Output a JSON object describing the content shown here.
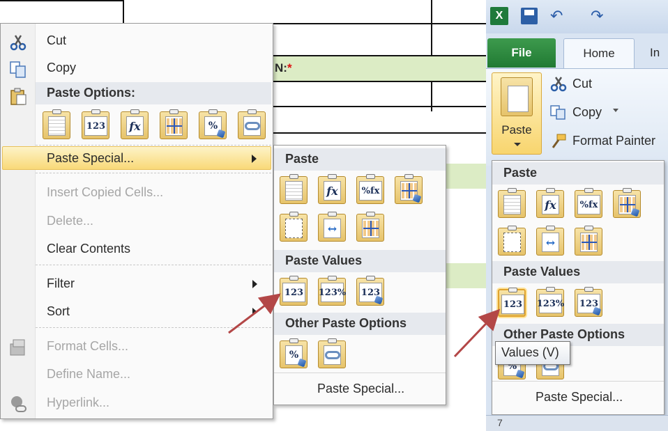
{
  "sheet": {
    "cell_label": "N:",
    "required_mark": "*"
  },
  "context_menu": {
    "items": {
      "cut": "Cut",
      "copy": "Copy",
      "paste_options_header": "Paste Options:",
      "paste_special": "Paste Special...",
      "insert_copied_cells": "Insert Copied Cells...",
      "delete": "Delete...",
      "clear_contents": "Clear Contents",
      "filter": "Filter",
      "sort": "Sort",
      "format_cells": "Format Cells...",
      "define_name": "Define Name...",
      "hyperlink": "Hyperlink..."
    },
    "paste_option_icons": [
      {
        "name": "paste-icon",
        "glyph": ""
      },
      {
        "name": "paste-values-icon",
        "glyph": "123"
      },
      {
        "name": "paste-formulas-icon",
        "glyph": "fx"
      },
      {
        "name": "transpose-icon",
        "glyph": ""
      },
      {
        "name": "paste-formatting-icon",
        "glyph": "%"
      },
      {
        "name": "paste-link-icon",
        "glyph": ""
      }
    ]
  },
  "submenu": {
    "headers": {
      "paste": "Paste",
      "paste_values": "Paste Values",
      "other_paste_options": "Other Paste Options"
    },
    "paste_special": "Paste Special...",
    "paste_icons": {
      "formulas": "fx",
      "formulas_number_format": "%fx",
      "values": "123",
      "values_number_format": "123%",
      "values_source_format": "123",
      "formatting": "%"
    }
  },
  "ribbon": {
    "tabs": {
      "file": "File",
      "home": "Home",
      "insert_partial": "In"
    },
    "paste_button": "Paste",
    "clipboard": {
      "cut": "Cut",
      "copy": "Copy",
      "format_painter": "Format Painter"
    },
    "gallery": {
      "headers": {
        "paste": "Paste",
        "paste_values": "Paste Values",
        "other_paste_options": "Other Paste Options"
      },
      "paste_special": "Paste Special..."
    },
    "tooltip": "Values (V)",
    "row_number": "7"
  },
  "colors": {
    "highlight": "#f9d978",
    "header_band": "#e6e9ee",
    "cell_green": "#dcecc5",
    "arrow": "#b34747",
    "file_tab": "#217a33"
  }
}
